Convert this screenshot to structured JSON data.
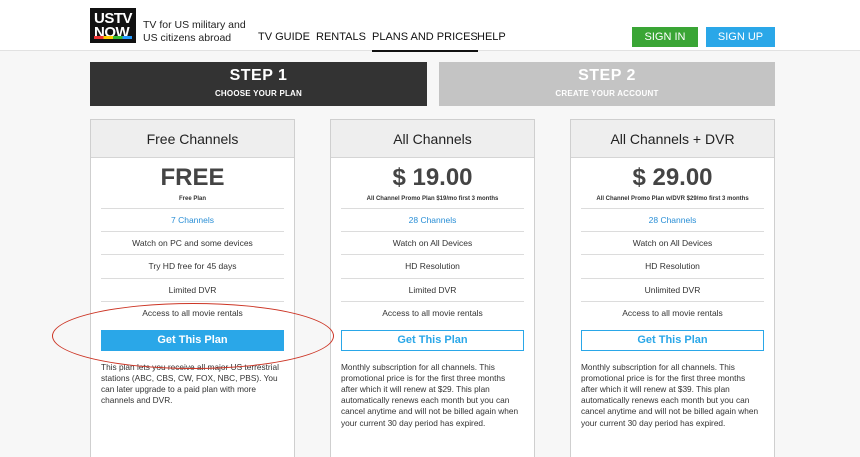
{
  "header": {
    "logo_line1": "USTV",
    "logo_line2": "NOW",
    "tagline": "TV for US military and US citizens abroad",
    "nav": [
      {
        "label": "TV GUIDE"
      },
      {
        "label": "RENTALS"
      },
      {
        "label": "PLANS AND PRICES"
      },
      {
        "label": "HELP"
      }
    ],
    "signin_label": "SIGN IN",
    "signup_label": "SIGN UP"
  },
  "steps": [
    {
      "title": "STEP 1",
      "subtitle": "CHOOSE YOUR PLAN",
      "active": true
    },
    {
      "title": "STEP 2",
      "subtitle": "CREATE YOUR ACCOUNT",
      "active": false
    }
  ],
  "plans": [
    {
      "name": "Free Channels",
      "price": "FREE",
      "subtext": "Free Plan",
      "features": [
        "7 Channels",
        "Watch on PC and some devices",
        "Try HD free for 45 days",
        "Limited DVR",
        "Access to all movie rentals"
      ],
      "cta": "Get This Plan",
      "description": "This plan lets you receive all major US terrestrial stations (ABC, CBS, CW, FOX, NBC, PBS). You can later upgrade to a paid plan with more channels and DVR."
    },
    {
      "name": "All Channels",
      "price": "$ 19.00",
      "subtext": "All Channel Promo Plan $19/mo first 3 months",
      "features": [
        "28 Channels",
        "Watch on All Devices",
        "HD Resolution",
        "Limited DVR",
        "Access to all movie rentals"
      ],
      "cta": "Get This Plan",
      "description": "Monthly subscription for all channels. This promotional price is for the first three months after which it will renew at $29. This plan automatically renews each month but you can cancel anytime and will not be billed again when your current 30 day period has expired."
    },
    {
      "name": "All Channels + DVR",
      "price": "$ 29.00",
      "subtext": "All Channel Promo Plan w/DVR $29/mo first 3 months",
      "features": [
        "28 Channels",
        "Watch on All Devices",
        "HD Resolution",
        "Unlimited DVR",
        "Access to all movie rentals"
      ],
      "cta": "Get This Plan",
      "description": "Monthly subscription for all channels. This promotional price is for the first three months after which it will renew at $39. This plan automatically renews each month but you can cancel anytime and will not be billed again when your current 30 day period has expired."
    }
  ],
  "colors": {
    "accent_blue": "#2aa7e8",
    "signin_green": "#3aa535",
    "step_active": "#333333",
    "step_inactive": "#c4c4c4",
    "annotation_red": "#cc3525"
  }
}
